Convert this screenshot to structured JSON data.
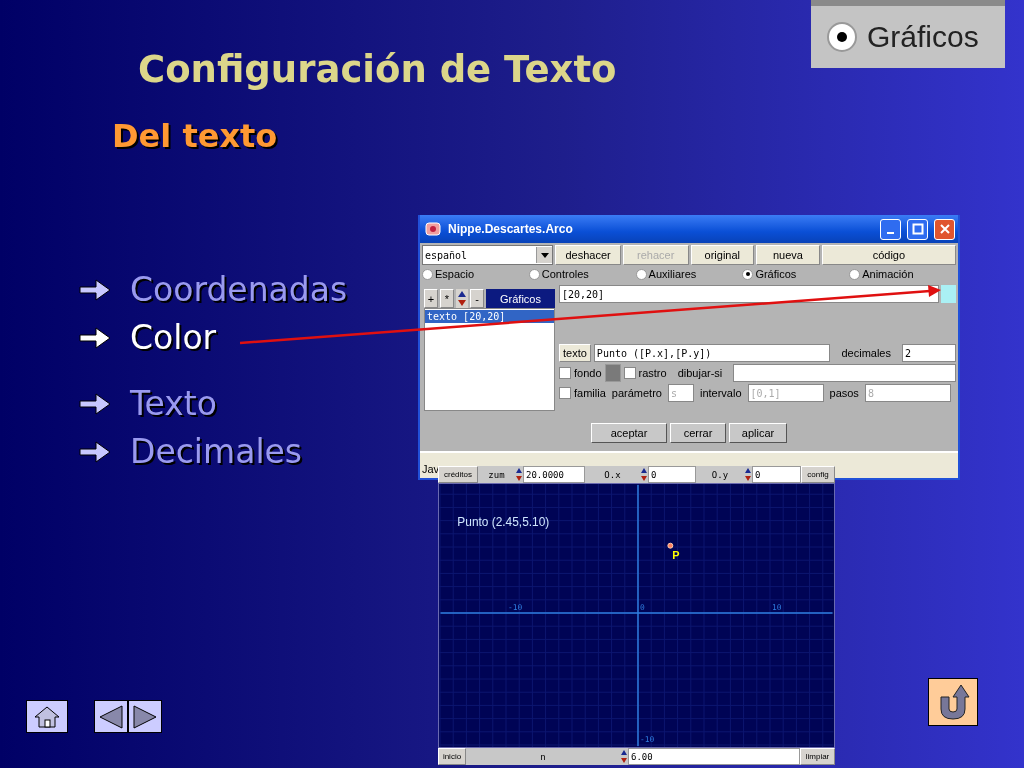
{
  "slide": {
    "title": "Configuración de Texto",
    "subtitle": "Del texto"
  },
  "inset": {
    "label": "Gráficos",
    "selected": true
  },
  "bullet_groups": [
    [
      {
        "text": "Coordenadas",
        "highlighted": false
      },
      {
        "text": "Color",
        "highlighted": true
      }
    ],
    [
      {
        "text": "Texto",
        "highlighted": false
      },
      {
        "text": "Decimales",
        "highlighted": false
      }
    ]
  ],
  "window": {
    "title": "Nippe.Descartes.Arco",
    "language": "español",
    "toolbar": [
      {
        "label": "deshacer",
        "disabled": false
      },
      {
        "label": "rehacer",
        "disabled": true
      },
      {
        "label": "original",
        "disabled": false
      },
      {
        "label": "nueva",
        "disabled": false
      },
      {
        "label": "código",
        "disabled": false
      }
    ],
    "tabs": [
      {
        "label": "Espacio",
        "selected": false
      },
      {
        "label": "Controles",
        "selected": false
      },
      {
        "label": "Auxiliares",
        "selected": false
      },
      {
        "label": "Gráficos",
        "selected": true
      },
      {
        "label": "Animación",
        "selected": false
      }
    ],
    "list_tools": [
      "+",
      "*",
      "-"
    ],
    "list_tab": "Gráficos",
    "list_items": [
      {
        "label": "texto [20,20]",
        "selected": true
      }
    ],
    "position": "[20,20]",
    "text_button": "texto",
    "text_value": "Punto ([P.x],[P.y])",
    "decimals_label": "decimales",
    "decimals_value": "2",
    "fondo": {
      "label": "fondo",
      "checked": false
    },
    "rastro": {
      "label": "rastro",
      "checked": false
    },
    "draw_if_label": "dibujar-si",
    "familia": {
      "label": "familia",
      "checked": false
    },
    "family_fields": [
      {
        "label": "parámetro",
        "value": "s",
        "disabled": true
      },
      {
        "label": "intervalo",
        "value": "[0,1]",
        "disabled": true
      },
      {
        "label": "pasos",
        "value": "8",
        "disabled": true
      }
    ],
    "actions": [
      "aceptar",
      "cerrar",
      "aplicar"
    ],
    "status": "Jav"
  },
  "scene": {
    "credits": "créditos",
    "zoom_label": "zum",
    "zoom": "20.0000",
    "ox_label": "O.x",
    "ox": "0",
    "oy_label": "O.y",
    "oy": "0",
    "config": "config",
    "point_label": "Punto (2.45,5.10)",
    "point_name": "P",
    "x_labels": [
      "-10",
      "0",
      "10"
    ],
    "y_labels": [
      "-10"
    ],
    "reset": "inicio",
    "n_label": "n",
    "n": "6.00",
    "clear": "limpiar"
  }
}
